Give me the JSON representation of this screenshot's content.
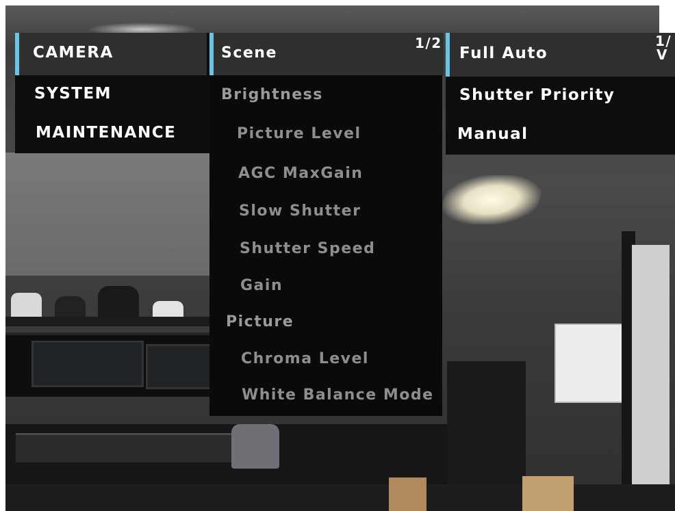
{
  "main_menu": {
    "items": [
      {
        "label": "CAMERA"
      },
      {
        "label": "SYSTEM"
      },
      {
        "label": "MAINTENANCE"
      }
    ]
  },
  "sub_menu": {
    "page_indicator": "1/2",
    "items": [
      {
        "label": "Scene"
      },
      {
        "label": "Brightness"
      },
      {
        "label": "Picture Level"
      },
      {
        "label": "AGC MaxGain"
      },
      {
        "label": "Slow Shutter"
      },
      {
        "label": "Shutter Speed"
      },
      {
        "label": "Gain"
      },
      {
        "label": "Picture"
      },
      {
        "label": "Chroma Level"
      },
      {
        "label": "White Balance Mode"
      }
    ]
  },
  "mode_menu": {
    "page_indicator_top": "1/",
    "page_indicator_arrow": "V",
    "items": [
      {
        "label": "Full Auto"
      },
      {
        "label": "Shutter Priority"
      },
      {
        "label": "Manual"
      }
    ]
  },
  "colors": {
    "accent": "#67c6e3",
    "selected_row": "#2f2f2f",
    "panel": "#0a0a0a",
    "active_text": "#ffffff",
    "inactive_text": "#8e8e8e"
  }
}
